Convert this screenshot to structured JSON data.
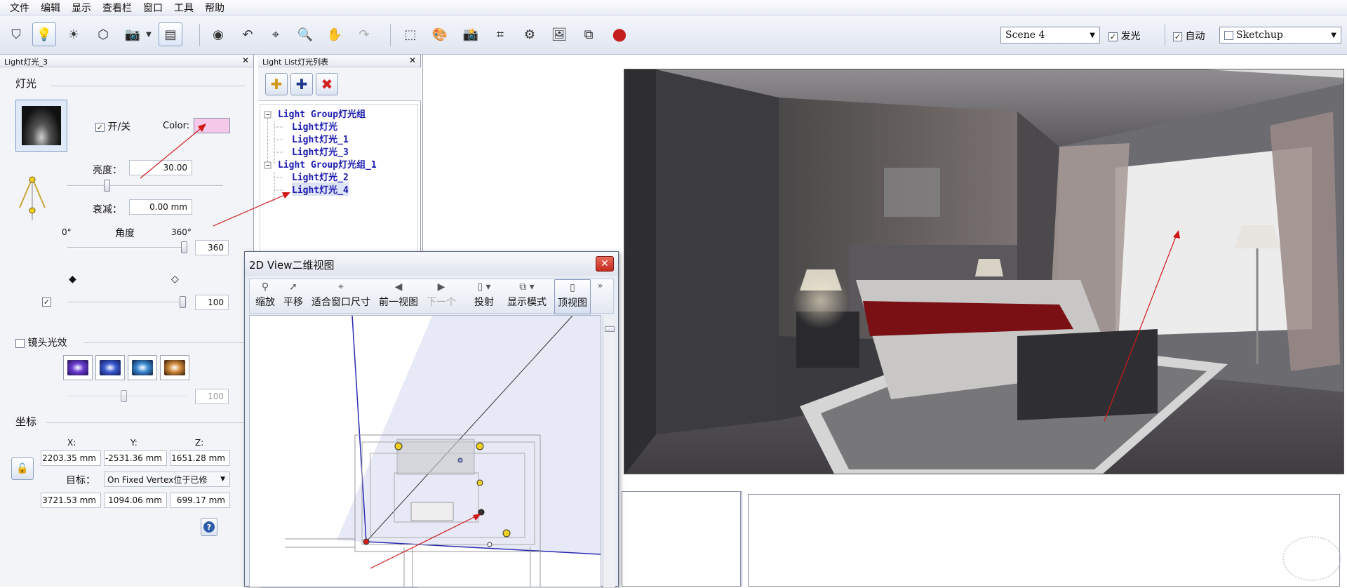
{
  "menu": [
    "文件",
    "编辑",
    "显示",
    "查看栏",
    "窗口",
    "工具",
    "帮助"
  ],
  "toolbar": {
    "scene_value": "Scene 4",
    "glow_label": "发光",
    "glow_checked": true,
    "auto_label": "自动",
    "auto_checked": true,
    "renderer_value": "Sketchup"
  },
  "light_panel": {
    "title": "Light灯光_3",
    "section_light": "灯光",
    "onoff_label": "开/关",
    "onoff_checked": true,
    "color_label": "Color:",
    "color_value": "#f6c8ea",
    "brightness_label": "亮度：",
    "brightness_value": "30.00",
    "decay_label": "衰减：",
    "decay_value": "0.00 mm",
    "angle_min": "0°",
    "angle_label": "角度",
    "angle_max": "360°",
    "angle_value": "360",
    "falloff_value": "100",
    "lens_label": "镜头光效",
    "lens_value": "100",
    "coords_label": "坐标",
    "x_label": "X:",
    "y_label": "Y:",
    "z_label": "Z:",
    "x_value": "2203.35 mm",
    "y_value": "-2531.36 mm",
    "z_value": "1651.28 mm",
    "target_label": "目标：",
    "target_value": "On Fixed Vertex位于已修",
    "tx_value": "3721.53 mm",
    "ty_value": "1094.06 mm",
    "tz_value": "699.17 mm"
  },
  "light_list": {
    "title": "Light List灯光列表",
    "items": [
      {
        "label": "Light Group灯光组"
      },
      {
        "label": "Light灯光"
      },
      {
        "label": "Light灯光_1"
      },
      {
        "label": "Light灯光_3"
      },
      {
        "label": "Light Group灯光组_1"
      },
      {
        "label": "Light灯光_2"
      },
      {
        "label": "Light灯光_4"
      }
    ]
  },
  "view2d": {
    "title": "2D View二维视图",
    "tools": [
      "缩放",
      "平移",
      "适合窗口尺寸",
      "前一视图",
      "下一个",
      "投射",
      "显示模式",
      "顶视图"
    ]
  },
  "colors": {
    "accent_blue": "#1a1ab0",
    "arrow_red": "#d01818"
  }
}
